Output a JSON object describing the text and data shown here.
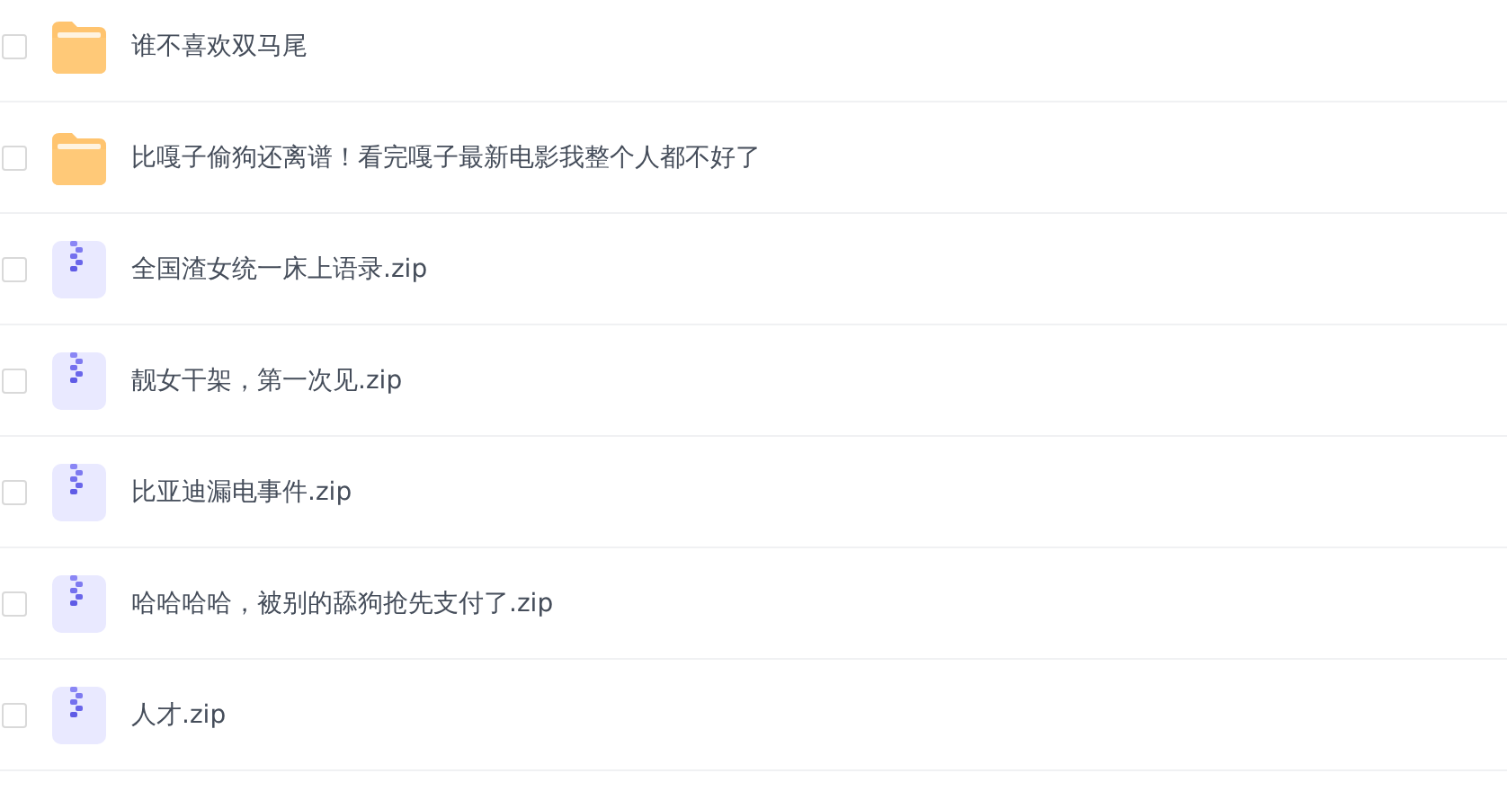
{
  "files": [
    {
      "kind": "folder",
      "name": "谁不喜欢双马尾",
      "checked": false
    },
    {
      "kind": "folder",
      "name": "比嘎子偷狗还离谱！看完嘎子最新电影我整个人都不好了",
      "checked": false
    },
    {
      "kind": "zip",
      "name": "全国渣女统一床上语录.zip",
      "checked": false
    },
    {
      "kind": "zip",
      "name": "靓女干架，第一次见.zip",
      "checked": false
    },
    {
      "kind": "zip",
      "name": "比亚迪漏电事件.zip",
      "checked": false
    },
    {
      "kind": "zip",
      "name": "哈哈哈哈，被别的舔狗抢先支付了.zip",
      "checked": false
    },
    {
      "kind": "zip",
      "name": "人才.zip",
      "checked": false
    }
  ]
}
